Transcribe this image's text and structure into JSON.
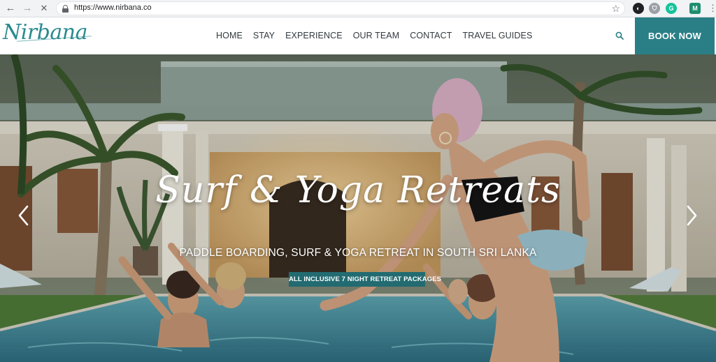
{
  "browser": {
    "url": "https://www.nirbana.co",
    "back_icon": "←",
    "forward_icon": "→",
    "stop_icon": "✕",
    "star_icon": "☆",
    "menu_icon": "⋮",
    "extensions": [
      {
        "name": "dark-extension-icon",
        "glyph": "◐",
        "color": "#202124"
      },
      {
        "name": "shield-extension-icon",
        "glyph": "⛉",
        "color": "#9aa0a6"
      },
      {
        "name": "grammarly-extension-icon",
        "glyph": "G",
        "color": "#15c39a"
      },
      {
        "name": "profile-avatar",
        "glyph": "M",
        "color": "#1e8e6e"
      }
    ]
  },
  "site": {
    "logo_text": "Nirbana",
    "nav": [
      "HOME",
      "STAY",
      "EXPERIENCE",
      "OUR TEAM",
      "CONTACT",
      "TRAVEL GUIDES"
    ],
    "book_now": "BOOK NOW",
    "accent_color": "#2a7f86"
  },
  "hero": {
    "title": "Surf & Yoga Retreats",
    "subtitle": "PADDLE BOARDING, SURF & YOGA RETREAT IN SOUTH SRI LANKA",
    "cta": "ALL INCLUSIVE 7 NIGHT RETREAT PACKAGES",
    "prev_icon": "chevron-left",
    "next_icon": "chevron-right"
  }
}
